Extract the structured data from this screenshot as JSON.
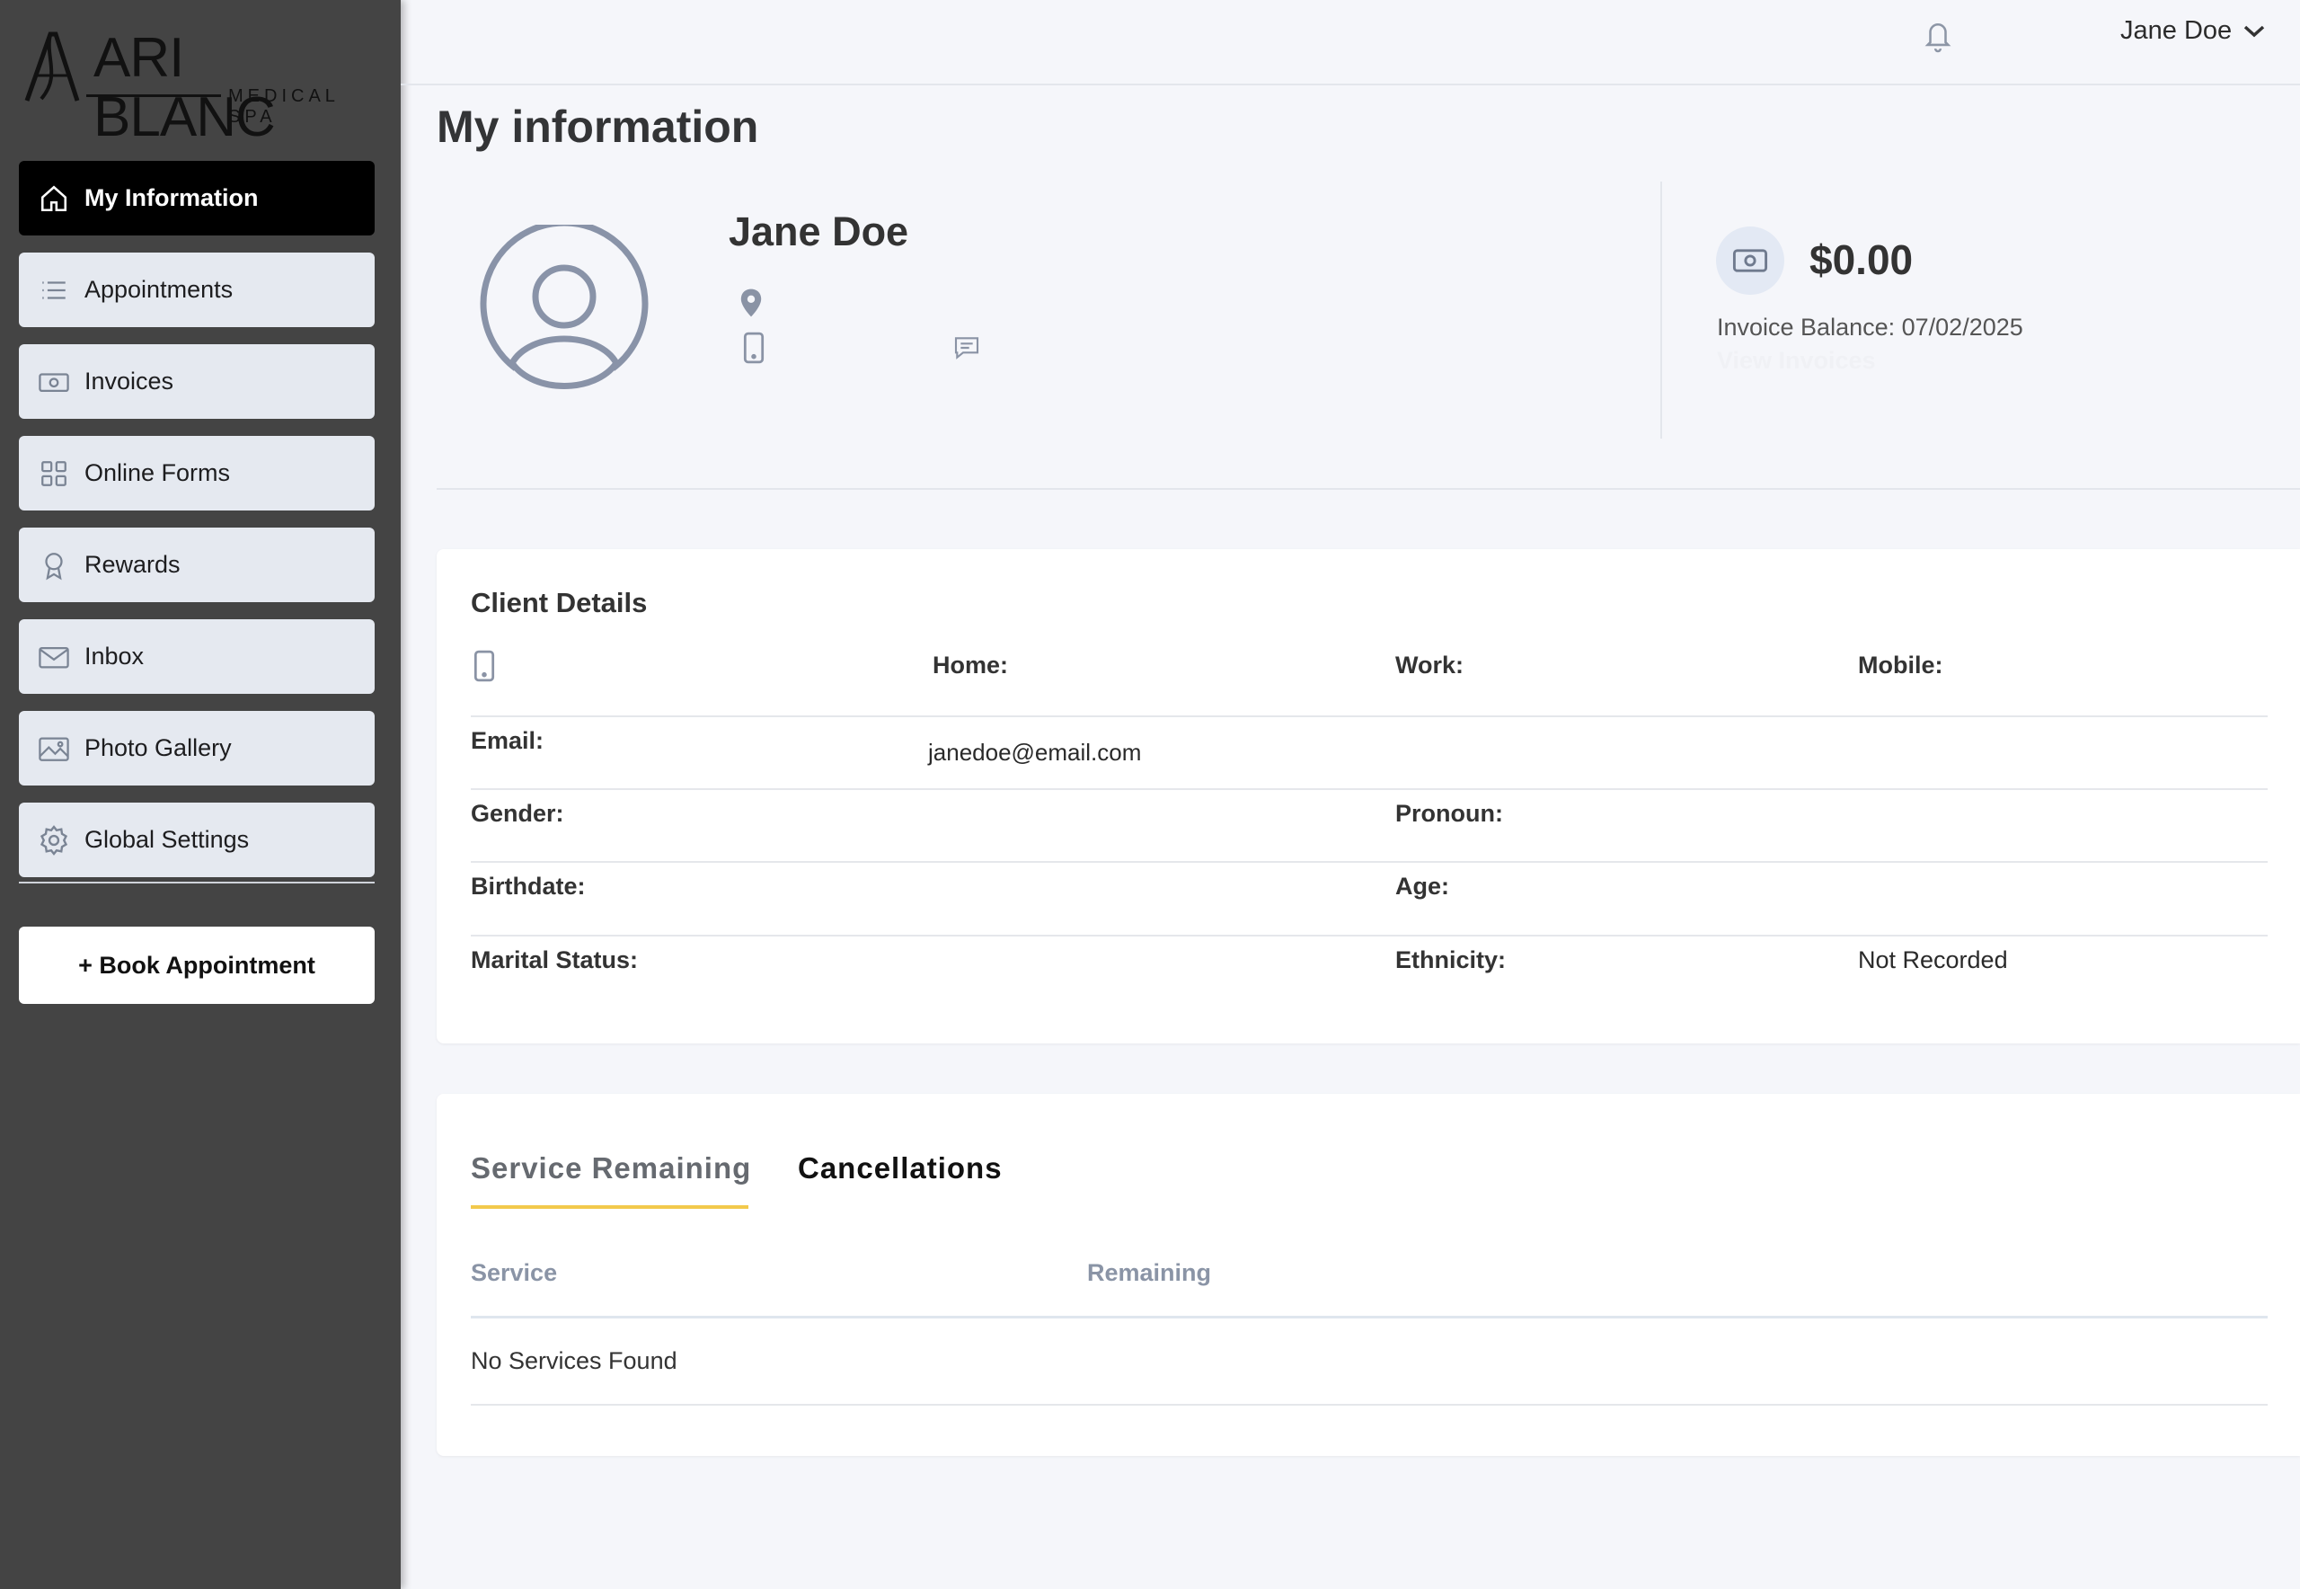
{
  "brand": {
    "name": "ARI BLANC",
    "tagline": "MEDICAL SPA"
  },
  "sidebar": {
    "items": [
      {
        "label": "My Information",
        "icon": "home-icon",
        "active": true
      },
      {
        "label": "Appointments",
        "icon": "list-icon",
        "active": false
      },
      {
        "label": "Invoices",
        "icon": "money-icon",
        "active": false
      },
      {
        "label": "Online Forms",
        "icon": "grid-icon",
        "active": false
      },
      {
        "label": "Rewards",
        "icon": "award-icon",
        "active": false
      },
      {
        "label": "Inbox",
        "icon": "mail-icon",
        "active": false
      },
      {
        "label": "Photo Gallery",
        "icon": "image-icon",
        "active": false
      },
      {
        "label": "Global Settings",
        "icon": "gear-icon",
        "active": false
      }
    ],
    "book_button": "+ Book Appointment"
  },
  "header": {
    "user_name": "Jane Doe"
  },
  "page": {
    "title": "My information"
  },
  "profile": {
    "name": "Jane Doe",
    "balance": "$0.00",
    "balance_caption": "Invoice Balance: 07/02/2025",
    "view_invoices": "View Invoices"
  },
  "client_details": {
    "title": "Client Details",
    "home_label": "Home:",
    "work_label": "Work:",
    "mobile_label": "Mobile:",
    "email_label": "Email:",
    "email_value": "janedoe@email.com",
    "gender_label": "Gender:",
    "pronoun_label": "Pronoun:",
    "birthdate_label": "Birthdate:",
    "age_label": "Age:",
    "marital_label": "Marital Status:",
    "ethnicity_label": "Ethnicity:",
    "ethnicity_value": "Not Recorded"
  },
  "services": {
    "tabs": [
      "Service Remaining",
      "Cancellations"
    ],
    "columns": [
      "Service",
      "Remaining"
    ],
    "empty_message": "No Services Found"
  },
  "colors": {
    "sidebar_bg": "#444444",
    "active_nav": "#000000",
    "nav_item_bg": "#e5e9f0",
    "tab_accent": "#f2c94c",
    "page_bg": "#f5f6fa"
  }
}
